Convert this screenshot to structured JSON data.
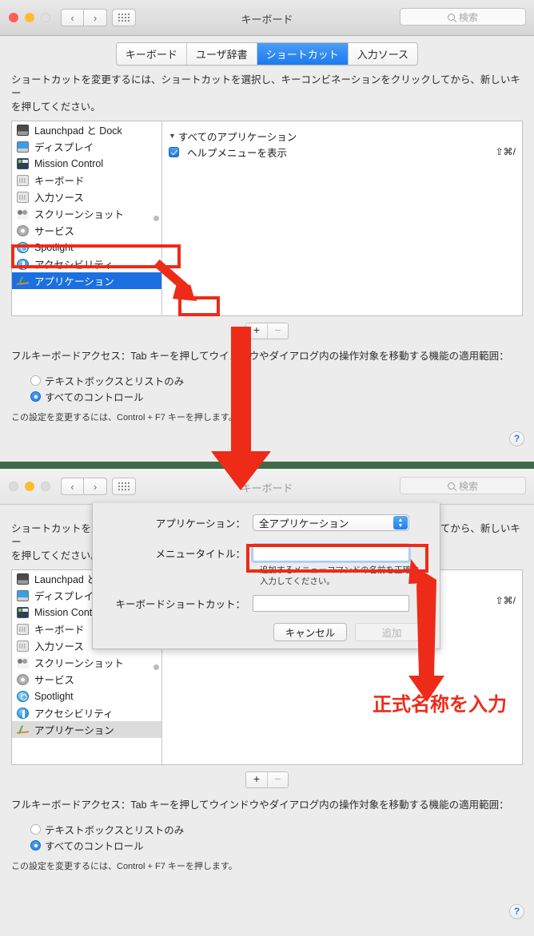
{
  "window_top": {
    "title": "キーボード",
    "search_placeholder": "検索",
    "nav_back": "‹",
    "nav_forward": "›",
    "help_label": "?"
  },
  "window_bottom": {
    "title": "キーボード",
    "search_placeholder": "検索",
    "nav_back": "‹",
    "nav_forward": "›",
    "help_label": "?"
  },
  "tabs": [
    {
      "label": "キーボード",
      "active": false
    },
    {
      "label": "ユーザ辞書",
      "active": false
    },
    {
      "label": "ショートカット",
      "active": true
    },
    {
      "label": "入力ソース",
      "active": false
    }
  ],
  "instructions": {
    "line1": "ショートカットを変更するには、ショートカットを選択し、キーコンビネーションをクリックしてから、新しいキー",
    "line2": "を押してください。"
  },
  "sidebar": {
    "items": [
      {
        "label": "Launchpad と Dock",
        "icon": "dock-icon"
      },
      {
        "label": "ディスプレイ",
        "icon": "display-icon"
      },
      {
        "label": "Mission Control",
        "icon": "mission-control-icon"
      },
      {
        "label": "キーボード",
        "icon": "keyboard-icon"
      },
      {
        "label": "入力ソース",
        "icon": "input-source-icon"
      },
      {
        "label": "スクリーンショット",
        "icon": "screenshot-icon"
      },
      {
        "label": "サービス",
        "icon": "services-gear-icon"
      },
      {
        "label": "Spotlight",
        "icon": "spotlight-icon"
      },
      {
        "label": "アクセシビリティ",
        "icon": "accessibility-icon"
      },
      {
        "label": "アプリケーション",
        "icon": "applications-icon"
      }
    ],
    "selected": "アプリケーション"
  },
  "shortcut_list": {
    "group_label": "すべてのアプリケーション",
    "disclosure": "▼",
    "rows": [
      {
        "label": "ヘルプメニューを表示",
        "keys": "⇧⌘/",
        "checked": true
      }
    ]
  },
  "plus_minus": {
    "plus": "+",
    "minus": "−"
  },
  "full_keyboard_access": {
    "label": "フルキーボードアクセス：Tab キーを押してウインドウやダイアログ内の操作対象を移動する機能の適用範囲：",
    "options": [
      {
        "label": "テキストボックスとリストのみ",
        "selected": false
      },
      {
        "label": "すべてのコントロール",
        "selected": true
      }
    ],
    "note": "この設定を変更するには、Control + F7 キーを押します。"
  },
  "dialog": {
    "application_label": "アプリケーション：",
    "application_value": "全アプリケーション",
    "menu_title_label": "メニュータイトル：",
    "menu_title_value": "",
    "menu_title_help": "追加するメニューコマンドの名前を正確に入力してください。",
    "keyboard_shortcut_label": "キーボードショートカット：",
    "keyboard_shortcut_value": "",
    "cancel_label": "キャンセル",
    "add_label": "追加"
  },
  "annotation": {
    "text": "正式名称を入力",
    "color": "#ee2b18"
  },
  "colors": {
    "accent_blue": "#1b7bee",
    "selection_blue": "#1b6fe0",
    "annotation_red": "#ee2b18",
    "separator_green": "#3f6b4a"
  }
}
